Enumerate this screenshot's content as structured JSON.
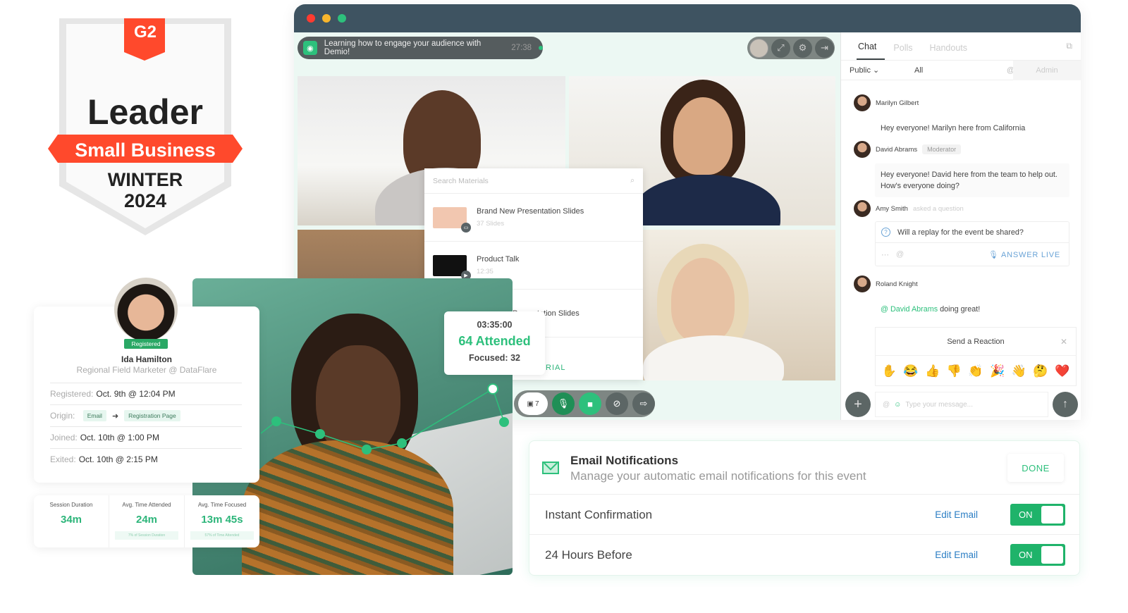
{
  "badge": {
    "brand": "G2",
    "title": "Leader",
    "category": "Small Business",
    "season": "WINTER",
    "year": "2024",
    "colors": {
      "ribbon": "#ff492c",
      "shield": "#e9e9e9"
    }
  },
  "window": {
    "traffic_lights": [
      "#ff3b30",
      "#f7b52c",
      "#2dc07c"
    ],
    "event": {
      "title": "Learning how to engage your audience with Demio!",
      "elapsed": "27:38",
      "status": "live"
    },
    "top_tools": [
      "avatar",
      "expand-icon",
      "gear-icon",
      "exit-icon"
    ],
    "materials": {
      "search_placeholder": "Search Materials",
      "items": [
        {
          "title": "Brand New Presentation Slides",
          "meta": "37 Slides",
          "type": "slides"
        },
        {
          "title": "Product Talk",
          "meta": "12:35",
          "type": "video"
        },
        {
          "title": "Presentation Slides",
          "meta": "",
          "type": "slides"
        }
      ],
      "add_label": "ADD MATERIAL"
    },
    "controls": {
      "presenters_count": "7",
      "buttons": [
        "mic-icon",
        "camera-icon",
        "screen-share-off-icon",
        "leave-icon"
      ]
    },
    "chat": {
      "tabs": [
        {
          "label": "Chat",
          "active": true
        },
        {
          "label": "Polls",
          "active": false
        },
        {
          "label": "Handouts",
          "active": false
        }
      ],
      "filter": {
        "visibility": "Public",
        "scope": "All",
        "mention": "@",
        "admin": "Admin"
      },
      "messages": [
        {
          "author": "Marilyn Gilbert",
          "text": "Hey everyone! Marilyn here from California"
        },
        {
          "author": "David Abrams",
          "badge": "Moderator",
          "text": "Hey everyone! David here from the team to help out. How's everyone doing?"
        },
        {
          "author": "Amy Smith",
          "note": "asked a question",
          "question": "Will a replay for the event be shared?",
          "action": "ANSWER LIVE"
        },
        {
          "author": "Roland Knight",
          "mention": "@ David Abrams",
          "text": " doing great!"
        }
      ],
      "reaction": {
        "title": "Send a Reaction",
        "emojis": [
          "✋",
          "😂",
          "👍",
          "👎",
          "👏",
          "🎉",
          "👋",
          "🤔",
          "❤️"
        ]
      },
      "input_placeholder": "Type your message..."
    }
  },
  "stat_card": {
    "time": "03:35:00",
    "attended": "64 Attended",
    "focused": "Focused: 32"
  },
  "profile": {
    "status": "Registered",
    "name": "Ida Hamilton",
    "role": "Regional Field Marketer @ DataFlare",
    "rows": {
      "registered_label": "Registered:",
      "registered_value": "Oct. 9th @ 12:04 PM",
      "origin_label": "Origin:",
      "origin_from": "Email",
      "origin_to": "Registration Page",
      "joined_label": "Joined:",
      "joined_value": "Oct. 10th @ 1:00 PM",
      "exited_label": "Exited:",
      "exited_value": "Oct. 10th @ 2:15 PM"
    }
  },
  "stats": [
    {
      "label": "Session Duration",
      "value": "34m",
      "note": ""
    },
    {
      "label": "Avg. Time Attended",
      "value": "24m",
      "note": "7% of Session Duration"
    },
    {
      "label": "Avg. Time Focused",
      "value": "13m 45s",
      "note": "57% of Time Attended"
    }
  ],
  "email": {
    "title": "Email Notifications",
    "subtitle": "Manage your automatic email notifications for this event",
    "done_label": "DONE",
    "rows": [
      {
        "name": "Instant Confirmation",
        "edit_label": "Edit Email",
        "toggle": "ON",
        "enabled": true
      },
      {
        "name": "24 Hours Before",
        "edit_label": "Edit Email",
        "toggle": "ON",
        "enabled": true
      }
    ]
  },
  "accent_color": "#2dc07c"
}
